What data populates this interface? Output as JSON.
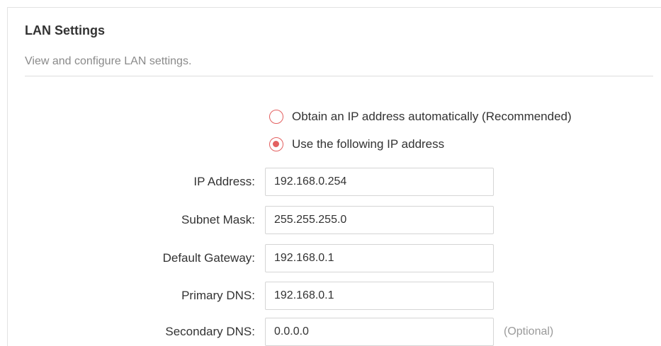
{
  "section": {
    "title": "LAN Settings",
    "description": "View and configure LAN settings."
  },
  "ip_mode": {
    "options": [
      {
        "label": "Obtain an IP address automatically (Recommended)",
        "selected": false
      },
      {
        "label": "Use the following IP address",
        "selected": true
      }
    ]
  },
  "fields": {
    "ip_address": {
      "label": "IP Address:",
      "value": "192.168.0.254"
    },
    "subnet_mask": {
      "label": "Subnet Mask:",
      "value": "255.255.255.0"
    },
    "default_gateway": {
      "label": "Default Gateway:",
      "value": "192.168.0.1"
    },
    "primary_dns": {
      "label": "Primary DNS:",
      "value": "192.168.0.1"
    },
    "secondary_dns": {
      "label": "Secondary DNS:",
      "value": "0.0.0.0",
      "hint": "(Optional)"
    }
  },
  "colors": {
    "accent": "#e36060",
    "text": "#333333",
    "muted": "#8a8a8a"
  }
}
